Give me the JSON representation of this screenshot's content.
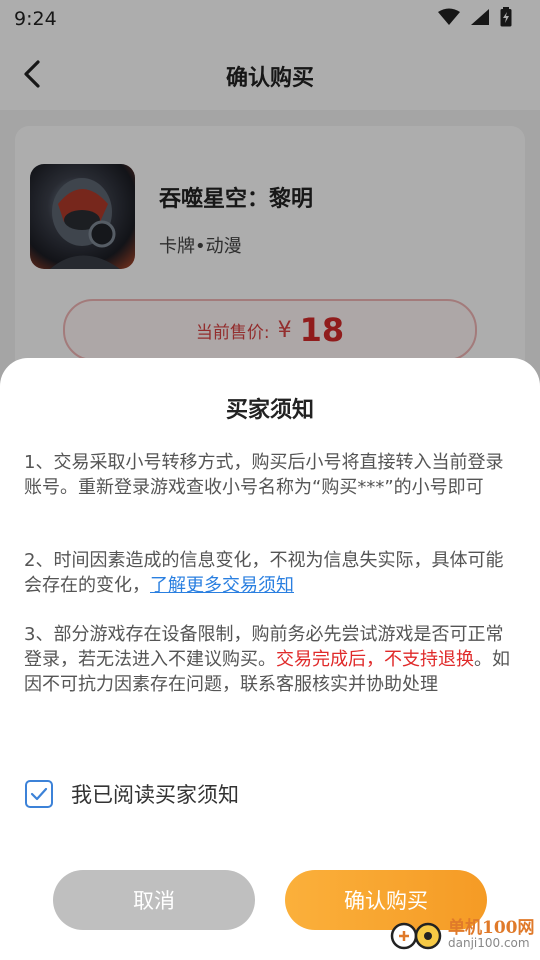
{
  "status_bar": {
    "time": "9:24",
    "icons": [
      "wifi-icon",
      "signal-icon",
      "battery-icon"
    ]
  },
  "nav": {
    "back_icon": "chevron-left-icon",
    "title": "确认购买"
  },
  "product": {
    "title": "吞噬星空：黎明",
    "tags": "卡牌•动漫",
    "price_label": "当前售价:",
    "price_currency": "¥",
    "price_value": "18"
  },
  "sheet": {
    "title": "买家须知",
    "notice_1": "1、交易采取小号转移方式，购买后小号将直接转入当前登录账号。重新登录游戏查收小号名称为“购买***”的小号即可",
    "notice_2_text": "2、时间因素造成的信息变化，不视为信息失实际，具体可能会存在的变化，",
    "notice_2_link": "了解更多交易须知",
    "notice_3_text_a": "3、部分游戏存在设备限制，购前务必先尝试游戏是否可正常登录，若无法进入不建议购买。",
    "notice_3_warning": "交易完成后，不支持退换",
    "notice_3_text_b": "。如因不可抗力因素存在问题，联系客服核实并协助处理",
    "agree_label": "我已阅读买家须知",
    "agree_checked": true,
    "cancel_label": "取消",
    "confirm_label": "确认购买"
  },
  "watermark": {
    "name": "单机100网",
    "url": "danji100.com"
  },
  "colors": {
    "accent_orange": "#f8a632",
    "price_red": "#d42a2a",
    "link_blue": "#2a7fe0",
    "warning_red": "#e02a2a",
    "checkbox_blue": "#3c82d8"
  }
}
